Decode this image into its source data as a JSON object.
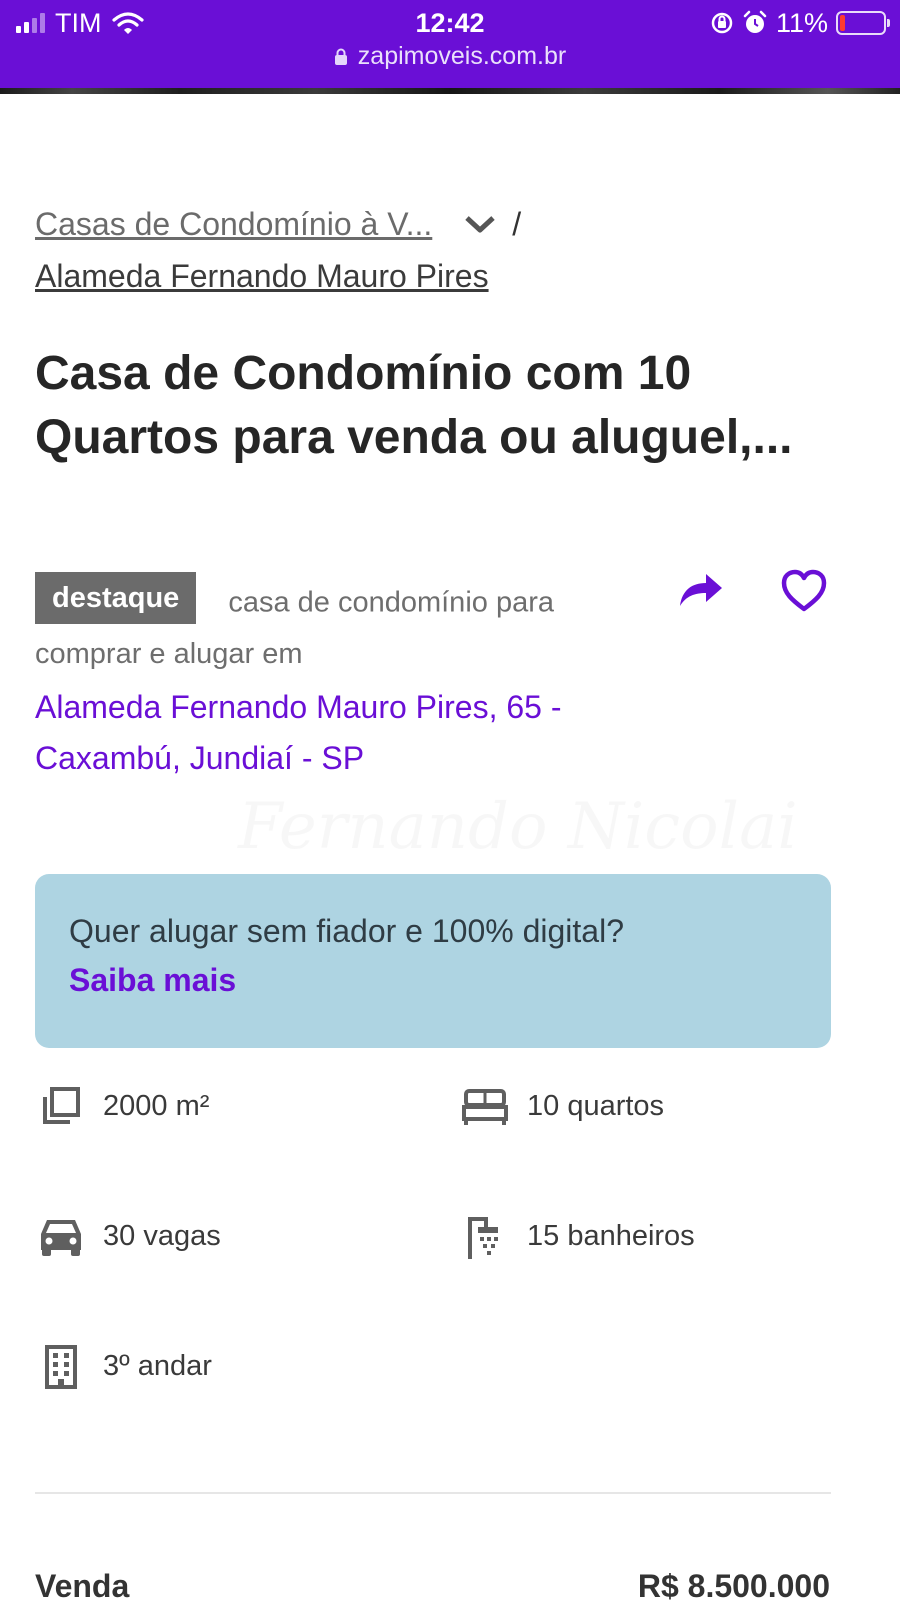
{
  "status_bar": {
    "carrier": "TIM",
    "time": "12:42",
    "battery": "11%",
    "battery_level": 0.11,
    "url": "zapimoveis.com.br"
  },
  "breadcrumb": {
    "link1": "Casas de Condomínio à V...",
    "separator": "/",
    "link2": "Alameda Fernando Mauro Pires"
  },
  "listing": {
    "title": "Casa de Condomínio com 10 Quartos para venda ou aluguel,...",
    "badge": "destaque",
    "description": "casa de condomínio para comprar e alugar em",
    "address": "Alameda Fernando Mauro Pires, 65 - Caxambú, Jundiaí - SP"
  },
  "banner": {
    "text": "Quer alugar sem fiador e 100% digital?",
    "link": "Saiba mais"
  },
  "features": {
    "area": "2000 m²",
    "bedrooms": "10 quartos",
    "parking": "30 vagas",
    "bathrooms": "15 banheiros",
    "floor": "3º andar"
  },
  "price": {
    "label": "Venda",
    "value": "R$ 8.500.000"
  },
  "colors": {
    "brand": "#6a0fd6",
    "banner_bg": "#aed4e2",
    "badge_bg": "#6b6b6b"
  },
  "icons": [
    "signal-icon",
    "wifi-icon",
    "lock-icon",
    "orientation-lock-icon",
    "alarm-icon",
    "battery-icon",
    "chevron-down-icon",
    "share-icon",
    "heart-icon",
    "area-icon",
    "bed-icon",
    "car-icon",
    "shower-icon",
    "building-icon"
  ]
}
